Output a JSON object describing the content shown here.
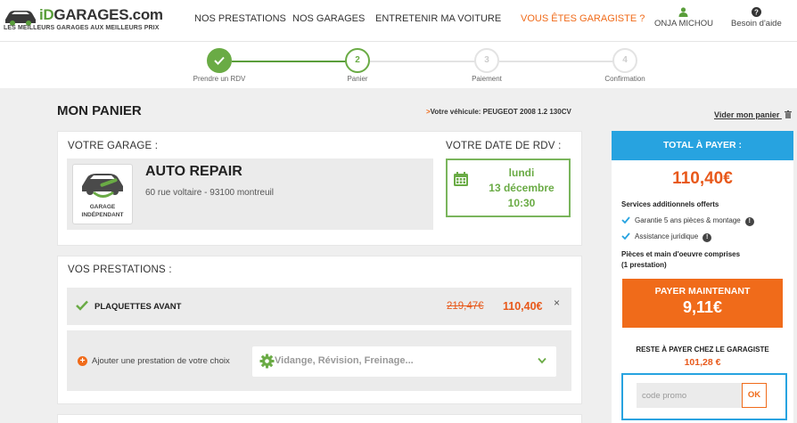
{
  "header": {
    "logo_brand_prefix": "iD",
    "logo_brand_suffix": "GARAGES.com",
    "logo_tagline": "LES MEILLEURS GARAGES AUX MEILLEURS PRIX",
    "nav": [
      {
        "label": "NOS PRESTATIONS"
      },
      {
        "label": "NOS GARAGES"
      },
      {
        "label": "ENTRETENIR MA VOITURE"
      },
      {
        "label": "VOUS ÊTES GARAGISTE ?"
      }
    ],
    "user_name": "ONJA MICHOU",
    "help_label": "Besoin d'aide"
  },
  "stepper": {
    "steps": [
      {
        "num": "1",
        "label": "Prendre un RDV",
        "state": "done"
      },
      {
        "num": "2",
        "label": "Panier",
        "state": "active"
      },
      {
        "num": "3",
        "label": "Paiement",
        "state": "todo"
      },
      {
        "num": "4",
        "label": "Confirmation",
        "state": "todo"
      }
    ]
  },
  "main": {
    "title": "MON PANIER",
    "vehicle_arrow": ">",
    "vehicle_text": "Votre véhicule: PEUGEOT 2008 1.2 130CV",
    "empty_cart": "Vider mon panier"
  },
  "garage": {
    "section_title": "VOTRE GARAGE :",
    "logo_text_line1": "GARAGE",
    "logo_text_line2": "INDÉPENDANT",
    "name": "AUTO REPAIR",
    "address": "60 rue voltaire - 93100 montreuil",
    "date_title": "VOTRE DATE DE RDV :",
    "date_day": "lundi",
    "date_date": "13 décembre",
    "date_time": "10:30"
  },
  "prestations": {
    "section_title": "VOS PRESTATIONS :",
    "items": [
      {
        "name": "PLAQUETTES AVANT",
        "old_price": "219,47€",
        "price": "110,40€",
        "remove": "×"
      }
    ],
    "add_label": "Ajouter une prestation de votre choix",
    "add_placeholder": "Vidange, Révision, Freinage..."
  },
  "summary": {
    "head": "TOTAL À PAYER :",
    "total": "110,40€",
    "services_title": "Services additionnels offerts",
    "services": [
      {
        "label": "Garantie 5 ans pièces & montage"
      },
      {
        "label": "Assistance juridique"
      }
    ],
    "included_line1": "Pièces et main d'oeuvre comprises",
    "included_line2": "(1 prestation)",
    "pay_label": "PAYER MAINTENANT",
    "pay_amount": "9,11€",
    "rest_label": "RESTE À PAYER CHEZ LE GARAGISTE",
    "rest_amount": "101,28 €",
    "promo_placeholder": "code promo",
    "promo_ok": "OK"
  },
  "colors": {
    "green": "#6aab45",
    "orange": "#f06b1a",
    "blue": "#27a3e0"
  }
}
